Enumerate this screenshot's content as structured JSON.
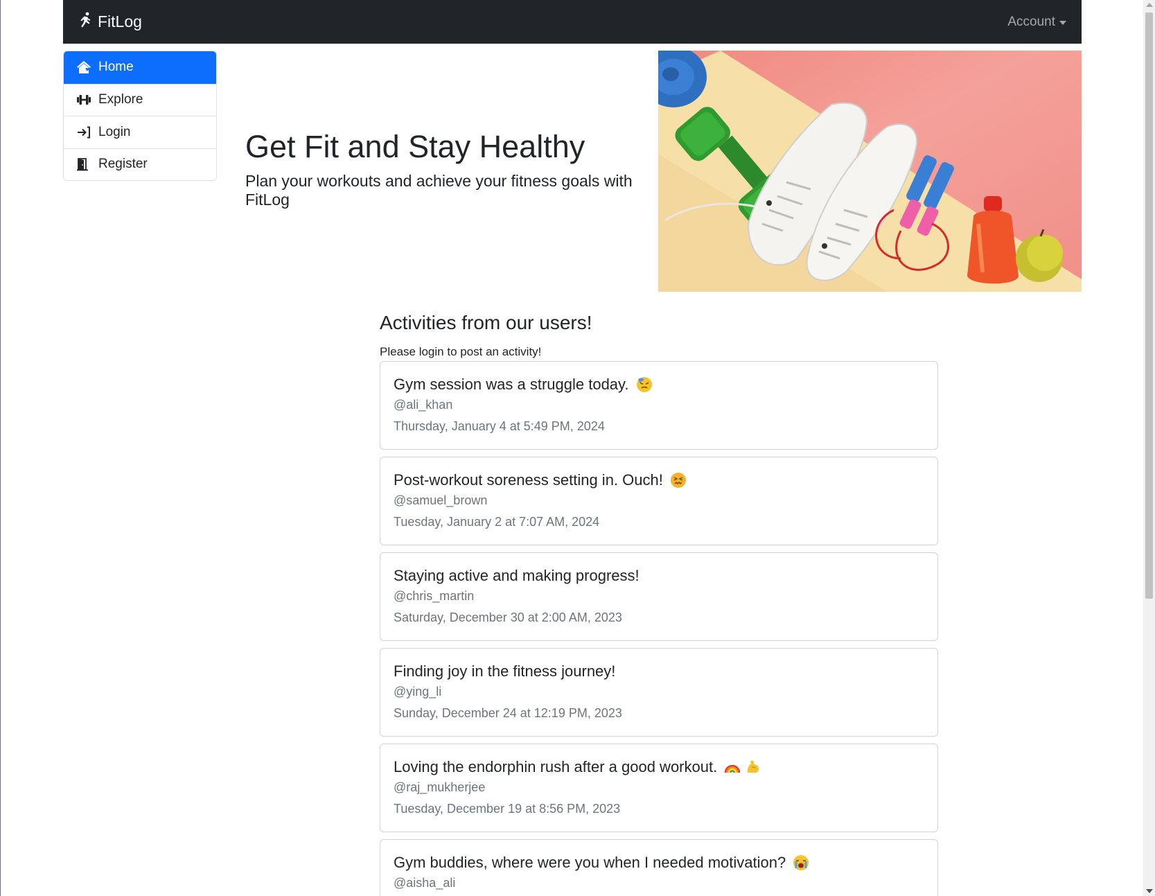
{
  "navbar": {
    "brand": "FitLog",
    "brand_icon": "running-person-icon",
    "account_label": "Account"
  },
  "sidebar": {
    "items": [
      {
        "label": "Home",
        "icon": "house-heart-icon",
        "active": true
      },
      {
        "label": "Explore",
        "icon": "dumbbell-icon",
        "active": false
      },
      {
        "label": "Login",
        "icon": "login-arrow-icon",
        "active": false
      },
      {
        "label": "Register",
        "icon": "door-open-icon",
        "active": false
      }
    ]
  },
  "hero": {
    "title": "Get Fit and Stay Healthy",
    "subtitle": "Plan your workouts and achieve your fitness goals with FitLog",
    "image_subject": "fitness-equipment-photo"
  },
  "feed": {
    "title": "Activities from our users!",
    "note": "Please login to post an activity!",
    "activities": [
      {
        "text": "Gym session was a struggle today.",
        "emoji": [
          "downcast-face-emoji"
        ],
        "user": "@ali_khan",
        "date": "Thursday, January 4 at 5:49 PM, 2024"
      },
      {
        "text": "Post-workout soreness setting in. Ouch!",
        "emoji": [
          "confounded-face-emoji"
        ],
        "user": "@samuel_brown",
        "date": "Tuesday, January 2 at 7:07 AM, 2024"
      },
      {
        "text": "Staying active and making progress!",
        "emoji": [],
        "user": "@chris_martin",
        "date": "Saturday, December 30 at 2:00 AM, 2023"
      },
      {
        "text": "Finding joy in the fitness journey!",
        "emoji": [],
        "user": "@ying_li",
        "date": "Sunday, December 24 at 12:19 PM, 2023"
      },
      {
        "text": "Loving the endorphin rush after a good workout.",
        "emoji": [
          "rainbow-emoji",
          "flexed-biceps-emoji"
        ],
        "user": "@raj_mukherjee",
        "date": "Tuesday, December 19 at 8:56 PM, 2023"
      },
      {
        "text": "Gym buddies, where were you when I needed motivation?",
        "emoji": [
          "crying-face-emoji"
        ],
        "user": "@aisha_ali",
        "date": ""
      }
    ]
  },
  "colors": {
    "navbar_bg": "#212529",
    "primary": "#0d6efd",
    "muted_text": "#6c757d",
    "border": "#dee2e6"
  }
}
